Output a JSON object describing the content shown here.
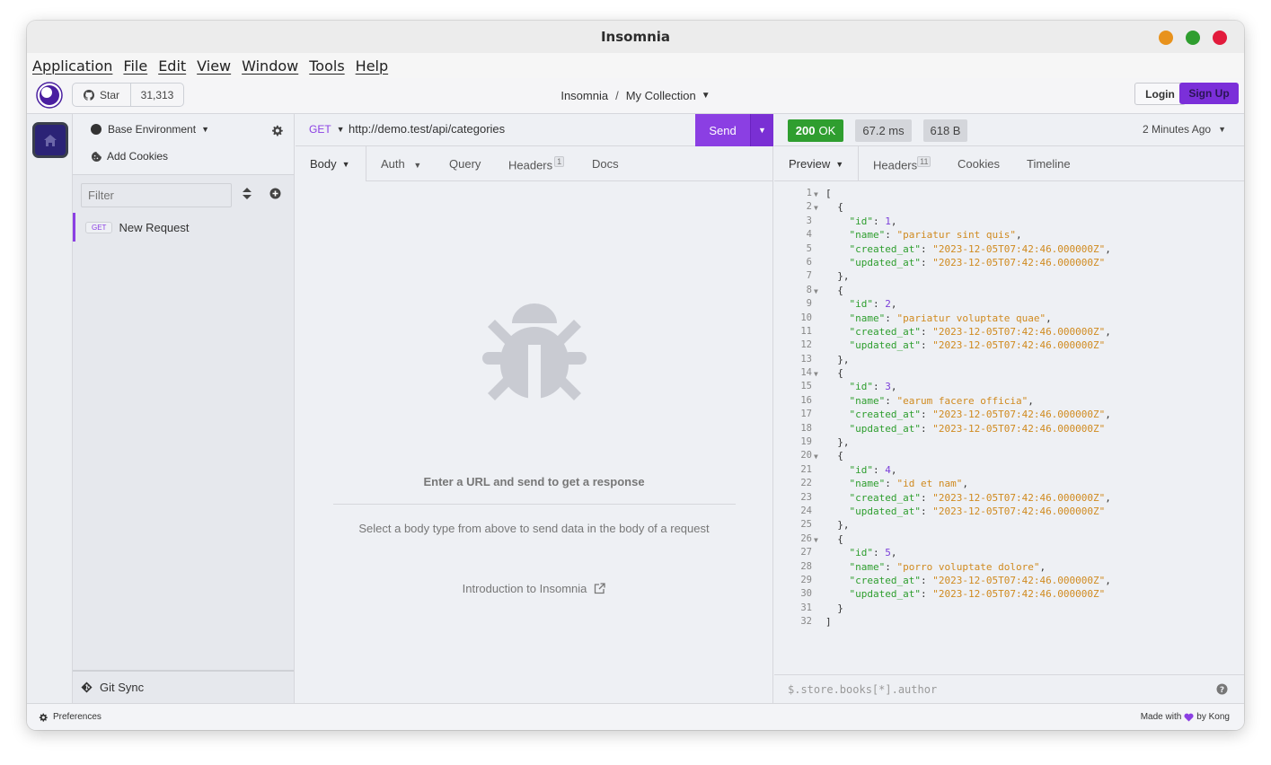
{
  "window": {
    "title": "Insomnia",
    "controls": [
      {
        "name": "minimize",
        "color": "#e8921c"
      },
      {
        "name": "maximize",
        "color": "#2f9e2f"
      },
      {
        "name": "close",
        "color": "#e21b3c"
      }
    ]
  },
  "menubar": [
    "Application",
    "File",
    "Edit",
    "View",
    "Window",
    "Tools",
    "Help"
  ],
  "header": {
    "star_label": "Star",
    "star_count": "31,313",
    "breadcrumb_root": "Insomnia",
    "breadcrumb_sep": "/",
    "collection": "My Collection",
    "login_label": "Login",
    "signup_label": "Sign Up"
  },
  "sidebar": {
    "environment": "Base Environment",
    "add_cookies": "Add Cookies",
    "filter_placeholder": "Filter",
    "requests": [
      {
        "method": "GET",
        "name": "New Request"
      }
    ],
    "git_sync": "Git Sync"
  },
  "request": {
    "method": "GET",
    "url": "http://demo.test/api/categories",
    "send_label": "Send",
    "tabs": {
      "body": "Body",
      "auth": "Auth",
      "query": "Query",
      "headers": "Headers",
      "headers_count": "1",
      "docs": "Docs"
    },
    "empty_title": "Enter a URL and send to get a response",
    "empty_hint": "Select a body type from above to send data in the body of a request",
    "intro_link": "Introduction to Insomnia"
  },
  "response": {
    "status_code": "200",
    "status_text": "OK",
    "time": "67.2 ms",
    "size": "618 B",
    "ago": "2 Minutes Ago",
    "tabs": {
      "preview": "Preview",
      "headers": "Headers",
      "headers_count": "11",
      "cookies": "Cookies",
      "timeline": "Timeline"
    },
    "items": [
      {
        "id": "1",
        "name": "pariatur sint quis",
        "created_at": "2023-12-05T07:42:46.000000Z",
        "updated_at": "2023-12-05T07:42:46.000000Z"
      },
      {
        "id": "2",
        "name": "pariatur voluptate quae",
        "created_at": "2023-12-05T07:42:46.000000Z",
        "updated_at": "2023-12-05T07:42:46.000000Z"
      },
      {
        "id": "3",
        "name": "earum facere officia",
        "created_at": "2023-12-05T07:42:46.000000Z",
        "updated_at": "2023-12-05T07:42:46.000000Z"
      },
      {
        "id": "4",
        "name": "id et nam",
        "created_at": "2023-12-05T07:42:46.000000Z",
        "updated_at": "2023-12-05T07:42:46.000000Z"
      },
      {
        "id": "5",
        "name": "porro voluptate dolore",
        "created_at": "2023-12-05T07:42:46.000000Z",
        "updated_at": "2023-12-05T07:42:46.000000Z"
      }
    ],
    "jsonpath_placeholder": "$.store.books[*].author"
  },
  "footer": {
    "preferences": "Preferences",
    "made_with": "Made with",
    "by": "by Kong"
  },
  "colors": {
    "accent": "#8b3fe3",
    "success": "#2f9e2f",
    "json_key": "#2e9e2e",
    "json_string": "#d08a1f",
    "json_number": "#7b3fd9"
  }
}
